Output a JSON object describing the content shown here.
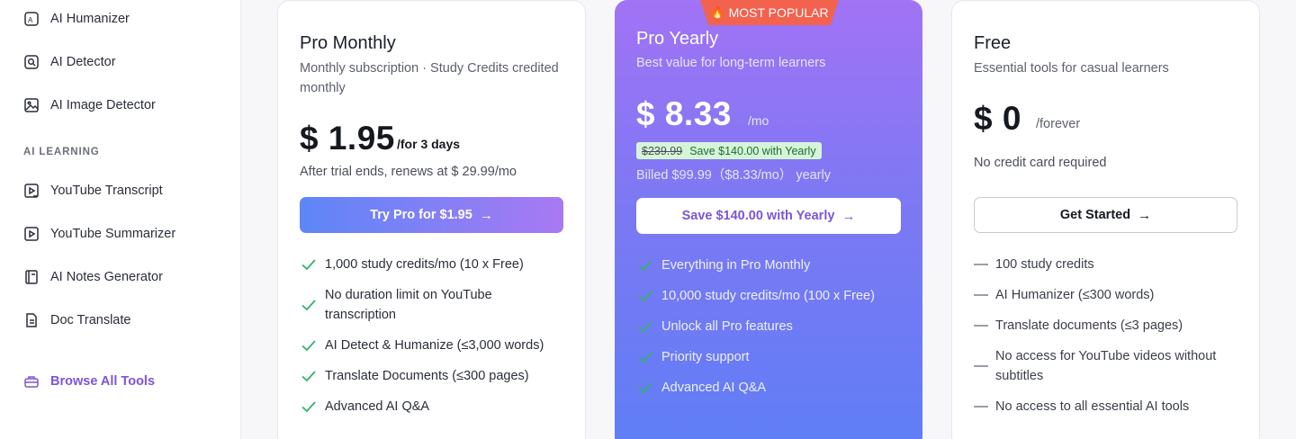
{
  "colors": {
    "accent": "#7c55d6",
    "check_green": "#2fb36b",
    "badge": "#f2624f",
    "yearly_top": "#a173f5",
    "yearly_bottom": "#5f7ef6"
  },
  "sidebar": {
    "items_top": [
      {
        "label": "AI Humanizer",
        "icon": "humanizer-icon"
      },
      {
        "label": "AI Detector",
        "icon": "detector-icon"
      },
      {
        "label": "AI Image Detector",
        "icon": "image-detector-icon"
      }
    ],
    "section_label": "AI LEARNING",
    "items_learning": [
      {
        "label": "YouTube Transcript",
        "icon": "youtube-transcript-icon"
      },
      {
        "label": "YouTube Summarizer",
        "icon": "youtube-summarizer-icon"
      },
      {
        "label": "AI Notes Generator",
        "icon": "notes-icon"
      },
      {
        "label": "Doc Translate",
        "icon": "doc-translate-icon"
      }
    ],
    "browse_label": "Browse All Tools"
  },
  "plans": {
    "monthly": {
      "title": "Pro Monthly",
      "subtitle": "Monthly subscription · Study Credits credited monthly",
      "price": "$ 1.95",
      "period": "/for 3 days",
      "note": "After trial ends, renews at $ 29.99/mo",
      "button": "Try Pro for $1.95",
      "features": [
        "1,000 study credits/mo (10 x Free)",
        "No duration limit on YouTube transcription",
        "AI Detect & Humanize (≤3,000 words)",
        "Translate Documents (≤300 pages)",
        "Advanced AI Q&A"
      ]
    },
    "yearly": {
      "badge": "MOST POPULAR",
      "title": "Pro Yearly",
      "subtitle": "Best value for long-term learners",
      "price": "$ 8.33",
      "period": "/mo",
      "original_price": "$239.99",
      "save_tag": "Save $140.00 with Yearly",
      "billed": "Billed $99.99（$8.33/mo） yearly",
      "button": "Save $140.00 with Yearly",
      "features": [
        "Everything in Pro Monthly",
        "10,000 study credits/mo (100 x Free)",
        "Unlock all Pro features",
        "Priority support",
        "Advanced AI Q&A"
      ]
    },
    "free": {
      "title": "Free",
      "subtitle": "Essential tools for casual learners",
      "price": "$ 0",
      "period": "/forever",
      "note": "No credit card required",
      "button": "Get Started",
      "features": [
        "100 study credits",
        "AI Humanizer (≤300 words)",
        "Translate documents (≤3 pages)",
        "No access for YouTube videos without subtitles",
        "No access to all essential AI tools"
      ]
    }
  }
}
